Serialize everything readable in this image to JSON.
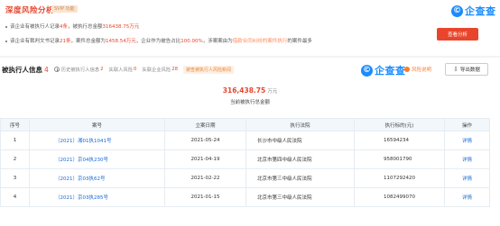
{
  "banner": {
    "title": "深度风险分析",
    "badge": "SVIP 功能",
    "brand_logo_char": "©",
    "brand_name": "企查查",
    "deep_button": "查看分析",
    "finding1": {
      "a": "该企业有被执行人记录",
      "count": "4条",
      "b": "，被执行总金额",
      "amount": "316438.75万元"
    },
    "finding2": {
      "a": "该企业有裁判文书记录",
      "count": "21条",
      "b": "，案件总金额为",
      "amount": "1458.54万元",
      "c": "，企业作为被告占比",
      "pct": "100.00%",
      "d": "，涉案案由为",
      "cause": "借款合同纠纷的案件执行",
      "e": "的案件最多"
    }
  },
  "section": {
    "title": "被执行人信息",
    "count": "4",
    "tabs": [
      {
        "label": "历史被执行人信息",
        "count": "2"
      },
      {
        "label": "失联人风险",
        "count": "0"
      },
      {
        "label": "失联企业风险",
        "count": "28"
      }
    ],
    "warn_tag": "被查被执行人风险新闻",
    "brand_name": "企查查",
    "risk_label": "风险说明",
    "export_label": "导出数据"
  },
  "summary": {
    "amount": "316,438.75",
    "unit": "万元",
    "caption": "当前被执行总金额"
  },
  "table": {
    "headers": [
      "序号",
      "案号",
      "立案日期",
      "执行法院",
      "执行标的(元)",
      "操作"
    ],
    "rows": [
      {
        "no": "1",
        "case": "（2021）湘01执1041号",
        "date": "2021-05-24",
        "court": "长沙市中级人民法院",
        "amount": "16594234",
        "action": "详情"
      },
      {
        "no": "2",
        "case": "（2021）京04执230号",
        "date": "2021-04-19",
        "court": "北京市第四中级人民法院",
        "amount": "958001790",
        "action": "详情"
      },
      {
        "no": "3",
        "case": "（2021）京03执62号",
        "date": "2021-02-22",
        "court": "北京市第三中级人民法院",
        "amount": "1107292420",
        "action": "详情"
      },
      {
        "no": "4",
        "case": "（2021）京03执285号",
        "date": "2021-01-15",
        "court": "北京市第三中级人民法院",
        "amount": "1082499070",
        "action": "详情"
      }
    ]
  },
  "colors": {
    "accent_red": "#e8452c",
    "brand_blue": "#1a8cff",
    "link_blue": "#1a6ad6",
    "header_bg": "#f2f7fc"
  }
}
